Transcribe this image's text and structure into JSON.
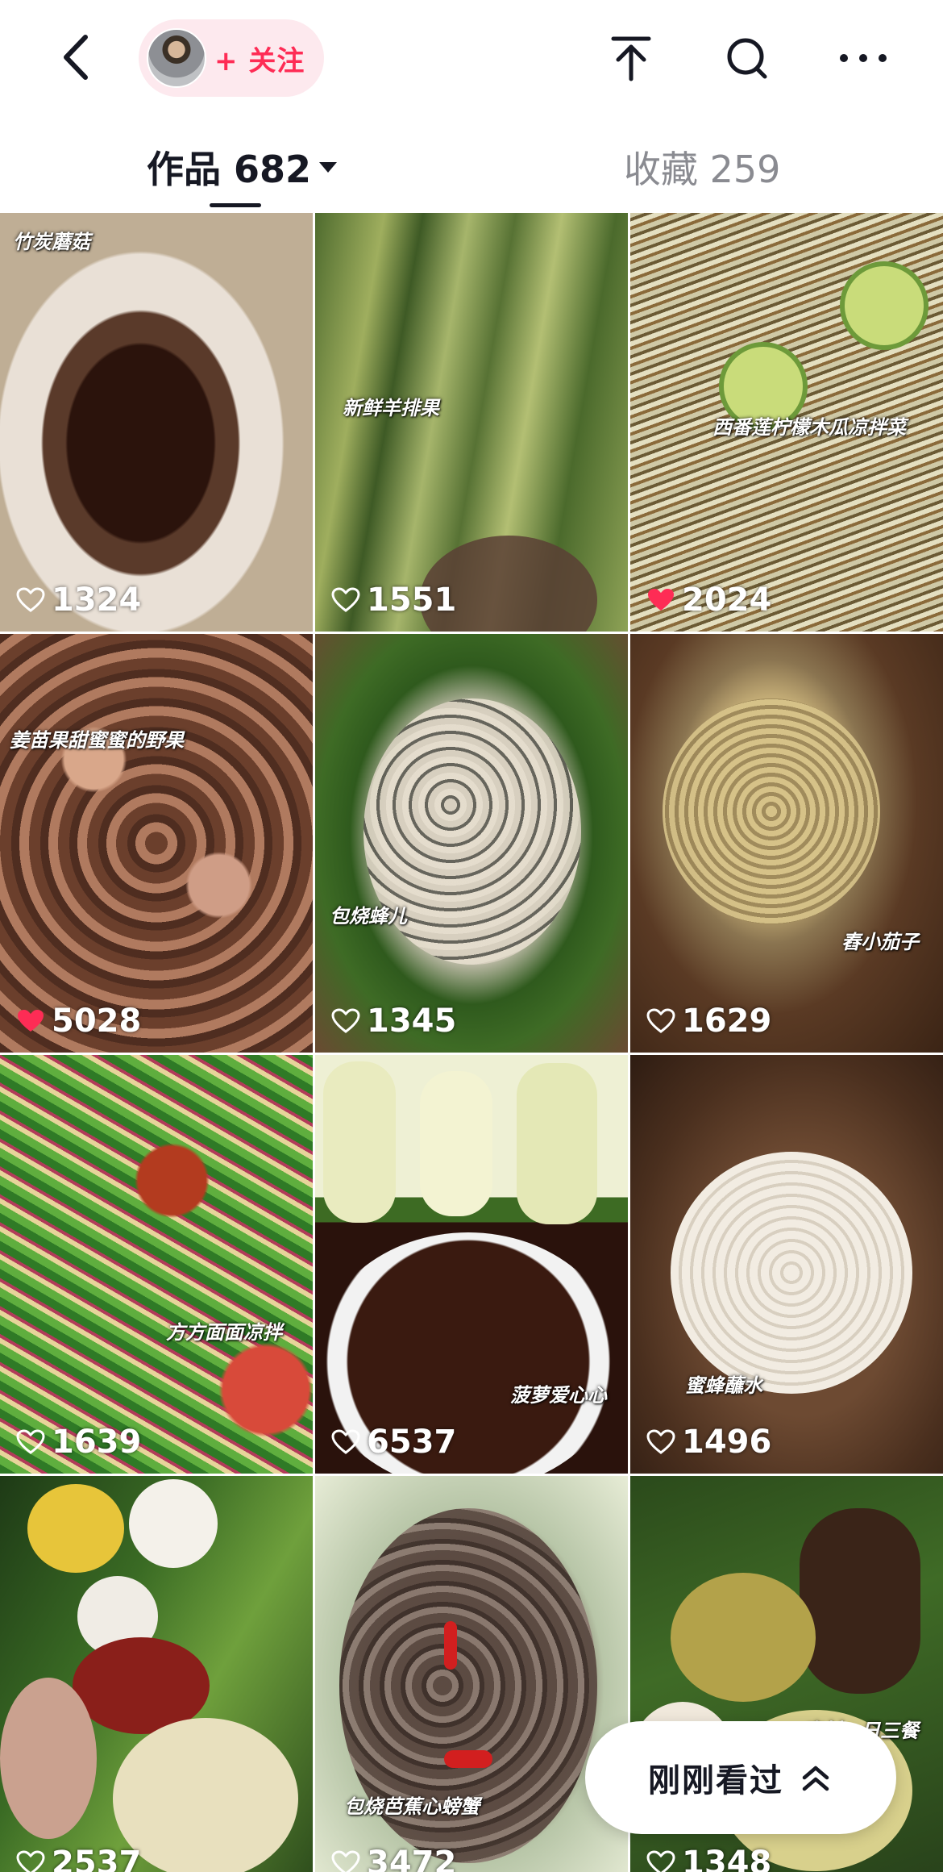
{
  "header": {
    "follow_label": "+ 关注",
    "icons": [
      "back-icon",
      "pin-top-icon",
      "search-icon",
      "more-icon"
    ]
  },
  "tabs": {
    "works_label": "作品 682",
    "collect_label": "收藏 259"
  },
  "videos": [
    {
      "title": "竹炭蘑菇",
      "likes": "1324",
      "liked": false
    },
    {
      "title": "新鲜羊排果",
      "likes": "1551",
      "liked": false
    },
    {
      "title": "西番莲柠檬木瓜凉拌菜",
      "likes": "2024",
      "liked": true
    },
    {
      "title": "姜苗果甜蜜蜜的野果",
      "likes": "5028",
      "liked": true
    },
    {
      "title": "包烧蜂儿",
      "likes": "1345",
      "liked": false
    },
    {
      "title": "舂小茄子",
      "likes": "1629",
      "liked": false
    },
    {
      "title": "方方面面凉拌",
      "likes": "1639",
      "liked": false
    },
    {
      "title": "菠萝爱心心",
      "likes": "6537",
      "liked": false
    },
    {
      "title": "蜜蜂蘸水",
      "likes": "1496",
      "liked": false
    },
    {
      "title": "",
      "likes": "2537",
      "liked": false
    },
    {
      "title": "包烧芭蕉心螃蟹",
      "likes": "3472",
      "liked": false
    },
    {
      "title": "农村一日三餐",
      "likes": "1348",
      "liked": false
    }
  ],
  "recent": {
    "label": "刚刚看过"
  },
  "colors": {
    "accent": "#fe2c55",
    "pill_bg": "#fde9ee",
    "text": "#161823",
    "muted": "#8a8b91"
  }
}
